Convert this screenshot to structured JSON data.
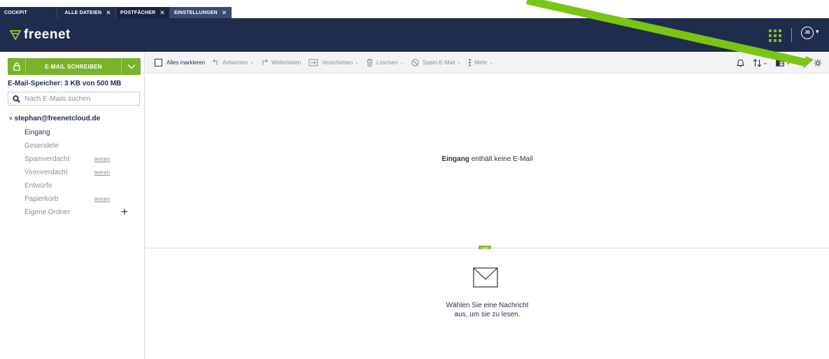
{
  "tabs": [
    {
      "label": "COCKPIT",
      "closable": false
    },
    {
      "label": "ALLE DATEIEN",
      "closable": true
    },
    {
      "label": "POSTFÄCHER",
      "closable": true,
      "active": true
    },
    {
      "label": "EINSTELLUNGEN",
      "closable": true
    }
  ],
  "header": {
    "brand": "freenet",
    "avatar_initials": "JB",
    "apps_icon": "apps-grid-icon",
    "colors": {
      "navy": "#1f2c4d",
      "green": "#7ab22b"
    }
  },
  "sidebar": {
    "compose_label": "E-MAIL SCHREIBEN",
    "storage": "E-Mail-Speicher: 3 KB von 500 MB",
    "search_placeholder": "Nach E-Mails suchen",
    "account": "stephan@freenetcloud.de",
    "folders": [
      {
        "label": "Eingang",
        "active": true
      },
      {
        "label": "Gesendete"
      },
      {
        "label": "Spamverdacht",
        "action": "leeren"
      },
      {
        "label": "Virenverdacht",
        "action": "leeren"
      },
      {
        "label": "Entwürfe"
      },
      {
        "label": "Papierkorb",
        "action": "leeren"
      },
      {
        "label": "Eigene Ordner"
      }
    ]
  },
  "toolbar": {
    "select_all": "Alles markieren",
    "reply": "Antworten",
    "forward": "Weiterleiten",
    "move": "Verschieben",
    "delete": "Löschen",
    "spam": "Spam-E-Mail",
    "more": "Mehr"
  },
  "list": {
    "folder_name": "Eingang",
    "empty_text": " enthält keine E-Mail"
  },
  "preview": {
    "line1": "Wählen Sie eine Nachricht",
    "line2": "aus, um sie zu lesen."
  }
}
